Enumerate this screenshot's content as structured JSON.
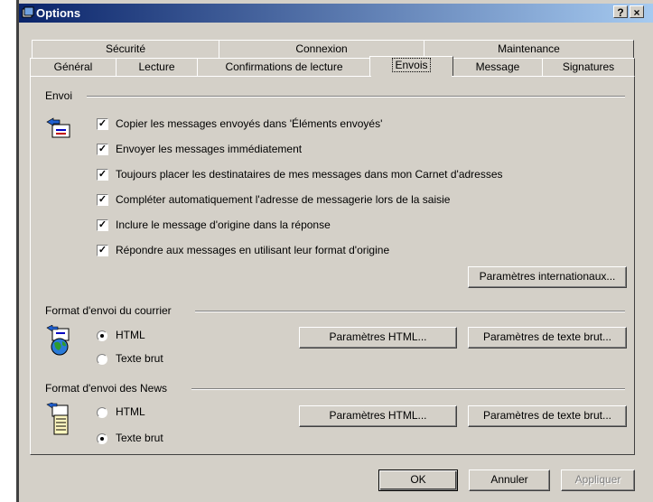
{
  "window": {
    "title": "Options",
    "help_btn": "?",
    "close_btn": "×"
  },
  "tabs_back": [
    {
      "label": "Sécurité"
    },
    {
      "label": "Connexion"
    },
    {
      "label": "Maintenance"
    }
  ],
  "tabs_front": [
    {
      "label": "Général"
    },
    {
      "label": "Lecture"
    },
    {
      "label": "Confirmations de lecture"
    },
    {
      "label": "Envois",
      "active": true
    },
    {
      "label": "Message"
    },
    {
      "label": "Signatures"
    }
  ],
  "envoi": {
    "label": "Envoi",
    "icon": "send-mail-icon",
    "options": [
      {
        "label": "Copier les messages envoyés dans 'Éléments envoyés'",
        "checked": true
      },
      {
        "label": "Envoyer les messages immédiatement",
        "checked": true
      },
      {
        "label": "Toujours placer les destinataires de mes messages dans mon Carnet d'adresses",
        "checked": true
      },
      {
        "label": "Compléter automatiquement l'adresse de messagerie lors de la saisie",
        "checked": true
      },
      {
        "label": "Inclure le message d'origine dans la réponse",
        "checked": true
      },
      {
        "label": "Répondre aux messages en utilisant leur format d'origine",
        "checked": true
      }
    ],
    "intl_button": "Paramètres internationaux..."
  },
  "mail_format": {
    "label": "Format d'envoi du courrier",
    "icon": "mail-globe-icon",
    "radio_html": "HTML",
    "radio_text": "Texte brut",
    "selected": "html",
    "html_button": "Paramètres HTML...",
    "text_button": "Paramètres de texte brut..."
  },
  "news_format": {
    "label": "Format d'envoi des News",
    "icon": "news-document-icon",
    "radio_html": "HTML",
    "radio_text": "Texte brut",
    "selected": "text",
    "html_button": "Paramètres HTML...",
    "text_button": "Paramètres de texte brut..."
  },
  "footer": {
    "ok": "OK",
    "cancel": "Annuler",
    "apply": "Appliquer"
  }
}
